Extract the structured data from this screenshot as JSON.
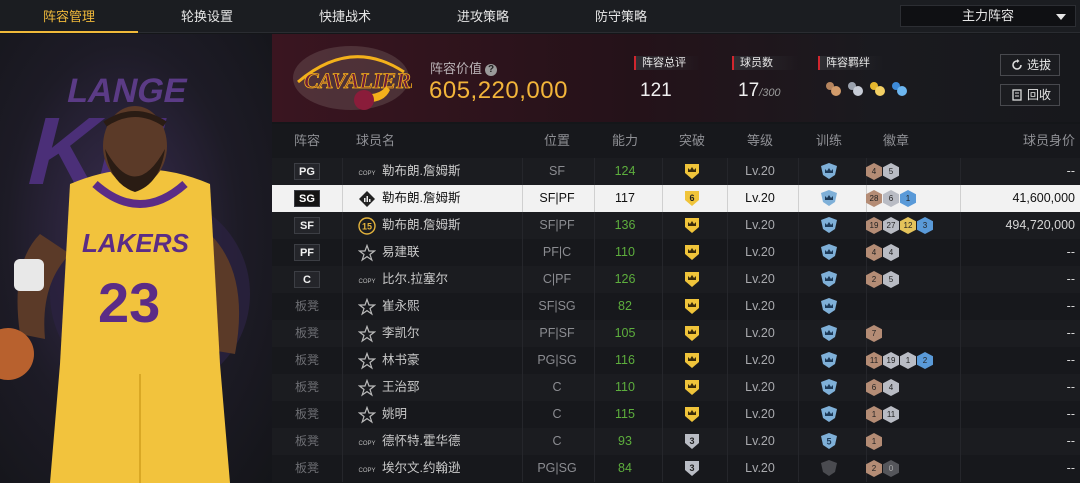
{
  "tabs": [
    {
      "label": "阵容管理",
      "active": true
    },
    {
      "label": "轮换设置",
      "active": false
    },
    {
      "label": "快捷战术",
      "active": false
    },
    {
      "label": "进攻策略",
      "active": false
    },
    {
      "label": "防守策略",
      "active": false
    }
  ],
  "lineup_dropdown": {
    "selected": "主力阵容"
  },
  "summary": {
    "value_label": "阵容价值",
    "value": "605,220,000",
    "rating_label": "阵容总评",
    "rating": "121",
    "player_count_label": "球员数",
    "player_count": "17",
    "player_cap": "/300",
    "bond_label": "阵容羁绊",
    "select_button": "选拔",
    "recycle_button": "回收"
  },
  "table": {
    "headers": [
      "阵容",
      "球员名",
      "位置",
      "能力",
      "突破",
      "等级",
      "训练",
      "徽章",
      "球员身价"
    ],
    "rows": [
      {
        "slot": "PG",
        "starter": true,
        "card": "COPY",
        "name": "勒布朗.詹姆斯",
        "pos": "SF",
        "ability": "124",
        "green": true,
        "break": "crown",
        "level": "Lv.20",
        "train": "crown",
        "badges": [
          {
            "t": "bronze",
            "v": "4"
          },
          {
            "t": "silver",
            "v": "5"
          }
        ],
        "worth": "--"
      },
      {
        "slot": "SG",
        "starter": true,
        "selected": true,
        "card": "chart",
        "name": "勒布朗.詹姆斯",
        "pos": "SF|PF",
        "ability": "117",
        "green": false,
        "break": "6",
        "level": "Lv.20",
        "train": "crown",
        "badges": [
          {
            "t": "bronze",
            "v": "28"
          },
          {
            "t": "silver",
            "v": "6"
          },
          {
            "t": "blue",
            "v": "1"
          }
        ],
        "worth": "41,600,000"
      },
      {
        "slot": "SF",
        "starter": true,
        "card": "15",
        "name": "勒布朗.詹姆斯",
        "pos": "SF|PF",
        "ability": "136",
        "green": true,
        "break": "crown",
        "level": "Lv.20",
        "train": "crown",
        "badges": [
          {
            "t": "bronze",
            "v": "19"
          },
          {
            "t": "silver",
            "v": "27"
          },
          {
            "t": "gold",
            "v": "12"
          },
          {
            "t": "blue",
            "v": "3"
          }
        ],
        "worth": "494,720,000"
      },
      {
        "slot": "PF",
        "starter": true,
        "card": "star",
        "name": "易建联",
        "pos": "PF|C",
        "ability": "110",
        "green": true,
        "break": "crown",
        "level": "Lv.20",
        "train": "crown",
        "badges": [
          {
            "t": "bronze",
            "v": "4"
          },
          {
            "t": "silver",
            "v": "4"
          }
        ],
        "worth": "--"
      },
      {
        "slot": "C",
        "starter": true,
        "card": "COPY",
        "name": "比尔.拉塞尔",
        "pos": "C|PF",
        "ability": "126",
        "green": true,
        "break": "crown",
        "level": "Lv.20",
        "train": "crown",
        "badges": [
          {
            "t": "bronze",
            "v": "2"
          },
          {
            "t": "silver",
            "v": "5"
          }
        ],
        "worth": "--"
      },
      {
        "slot": "板凳",
        "starter": false,
        "card": "star",
        "name": "崔永熙",
        "pos": "SF|SG",
        "ability": "82",
        "green": true,
        "break": "crown",
        "level": "Lv.20",
        "train": "crown",
        "badges": [],
        "worth": "--"
      },
      {
        "slot": "板凳",
        "starter": false,
        "card": "star",
        "name": "李凯尔",
        "pos": "PF|SF",
        "ability": "105",
        "green": true,
        "break": "crown",
        "level": "Lv.20",
        "train": "crown",
        "badges": [
          {
            "t": "bronze",
            "v": "7"
          }
        ],
        "worth": "--"
      },
      {
        "slot": "板凳",
        "starter": false,
        "card": "star",
        "name": "林书豪",
        "pos": "PG|SG",
        "ability": "116",
        "green": true,
        "break": "crown",
        "level": "Lv.20",
        "train": "crown",
        "badges": [
          {
            "t": "bronze",
            "v": "11"
          },
          {
            "t": "silver",
            "v": "19"
          },
          {
            "t": "silver",
            "v": "1"
          },
          {
            "t": "blue",
            "v": "2"
          }
        ],
        "worth": "--"
      },
      {
        "slot": "板凳",
        "starter": false,
        "card": "star",
        "name": "王治郅",
        "pos": "C",
        "ability": "110",
        "green": true,
        "break": "crown",
        "level": "Lv.20",
        "train": "crown",
        "badges": [
          {
            "t": "bronze",
            "v": "6"
          },
          {
            "t": "silver",
            "v": "4"
          }
        ],
        "worth": "--"
      },
      {
        "slot": "板凳",
        "starter": false,
        "card": "star",
        "name": "姚明",
        "pos": "C",
        "ability": "115",
        "green": true,
        "break": "crown",
        "level": "Lv.20",
        "train": "crown",
        "badges": [
          {
            "t": "bronze",
            "v": "1"
          },
          {
            "t": "silver",
            "v": "11"
          }
        ],
        "worth": "--"
      },
      {
        "slot": "板凳",
        "starter": false,
        "card": "COPY",
        "name": "德怀特.霍华德",
        "pos": "C",
        "ability": "93",
        "green": true,
        "break": "3",
        "level": "Lv.20",
        "train": "5",
        "badges": [
          {
            "t": "bronze",
            "v": "1"
          }
        ],
        "worth": "--"
      },
      {
        "slot": "板凳",
        "starter": false,
        "card": "COPY",
        "name": "埃尔文.约翰逊",
        "pos": "PG|SG",
        "ability": "84",
        "green": true,
        "break": "3",
        "level": "Lv.20",
        "train": "dark",
        "badges": [
          {
            "t": "bronze",
            "v": "2"
          },
          {
            "t": "dark",
            "v": "0"
          }
        ],
        "worth": "--"
      }
    ]
  },
  "colors": {
    "accent": "#f0b93a",
    "ability_green": "#5dae3d",
    "red_marker": "#d0262e",
    "badge_blue": "#5a9ad8"
  },
  "icons": {
    "help": "question-circle-icon",
    "select": "refresh-icon",
    "recycle": "recycle-bin-icon"
  }
}
